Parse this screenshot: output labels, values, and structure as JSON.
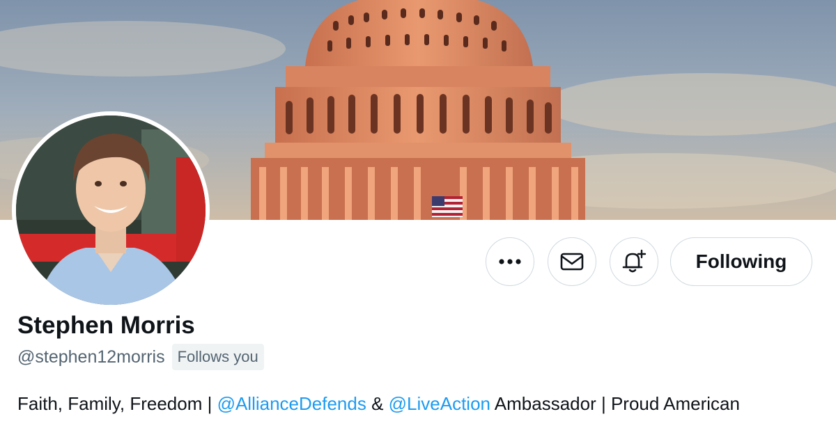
{
  "profile": {
    "name": "Stephen Morris",
    "handle": "@stephen12morris",
    "follows_you": "Follows you",
    "bio": {
      "part1": "Faith, Family, Freedom | ",
      "mention1": "@AllianceDefends",
      "part2": " & ",
      "mention2": "@LiveAction",
      "part3": " Ambassador | Proud American"
    }
  },
  "actions": {
    "more_icon": "ellipsis-icon",
    "message_icon": "envelope-icon",
    "notify_icon": "bell-plus-icon",
    "following_label": "Following"
  },
  "colors": {
    "link": "#1d9bf0",
    "text": "#0f1419",
    "secondary": "#536471",
    "border": "#cfd9de"
  }
}
